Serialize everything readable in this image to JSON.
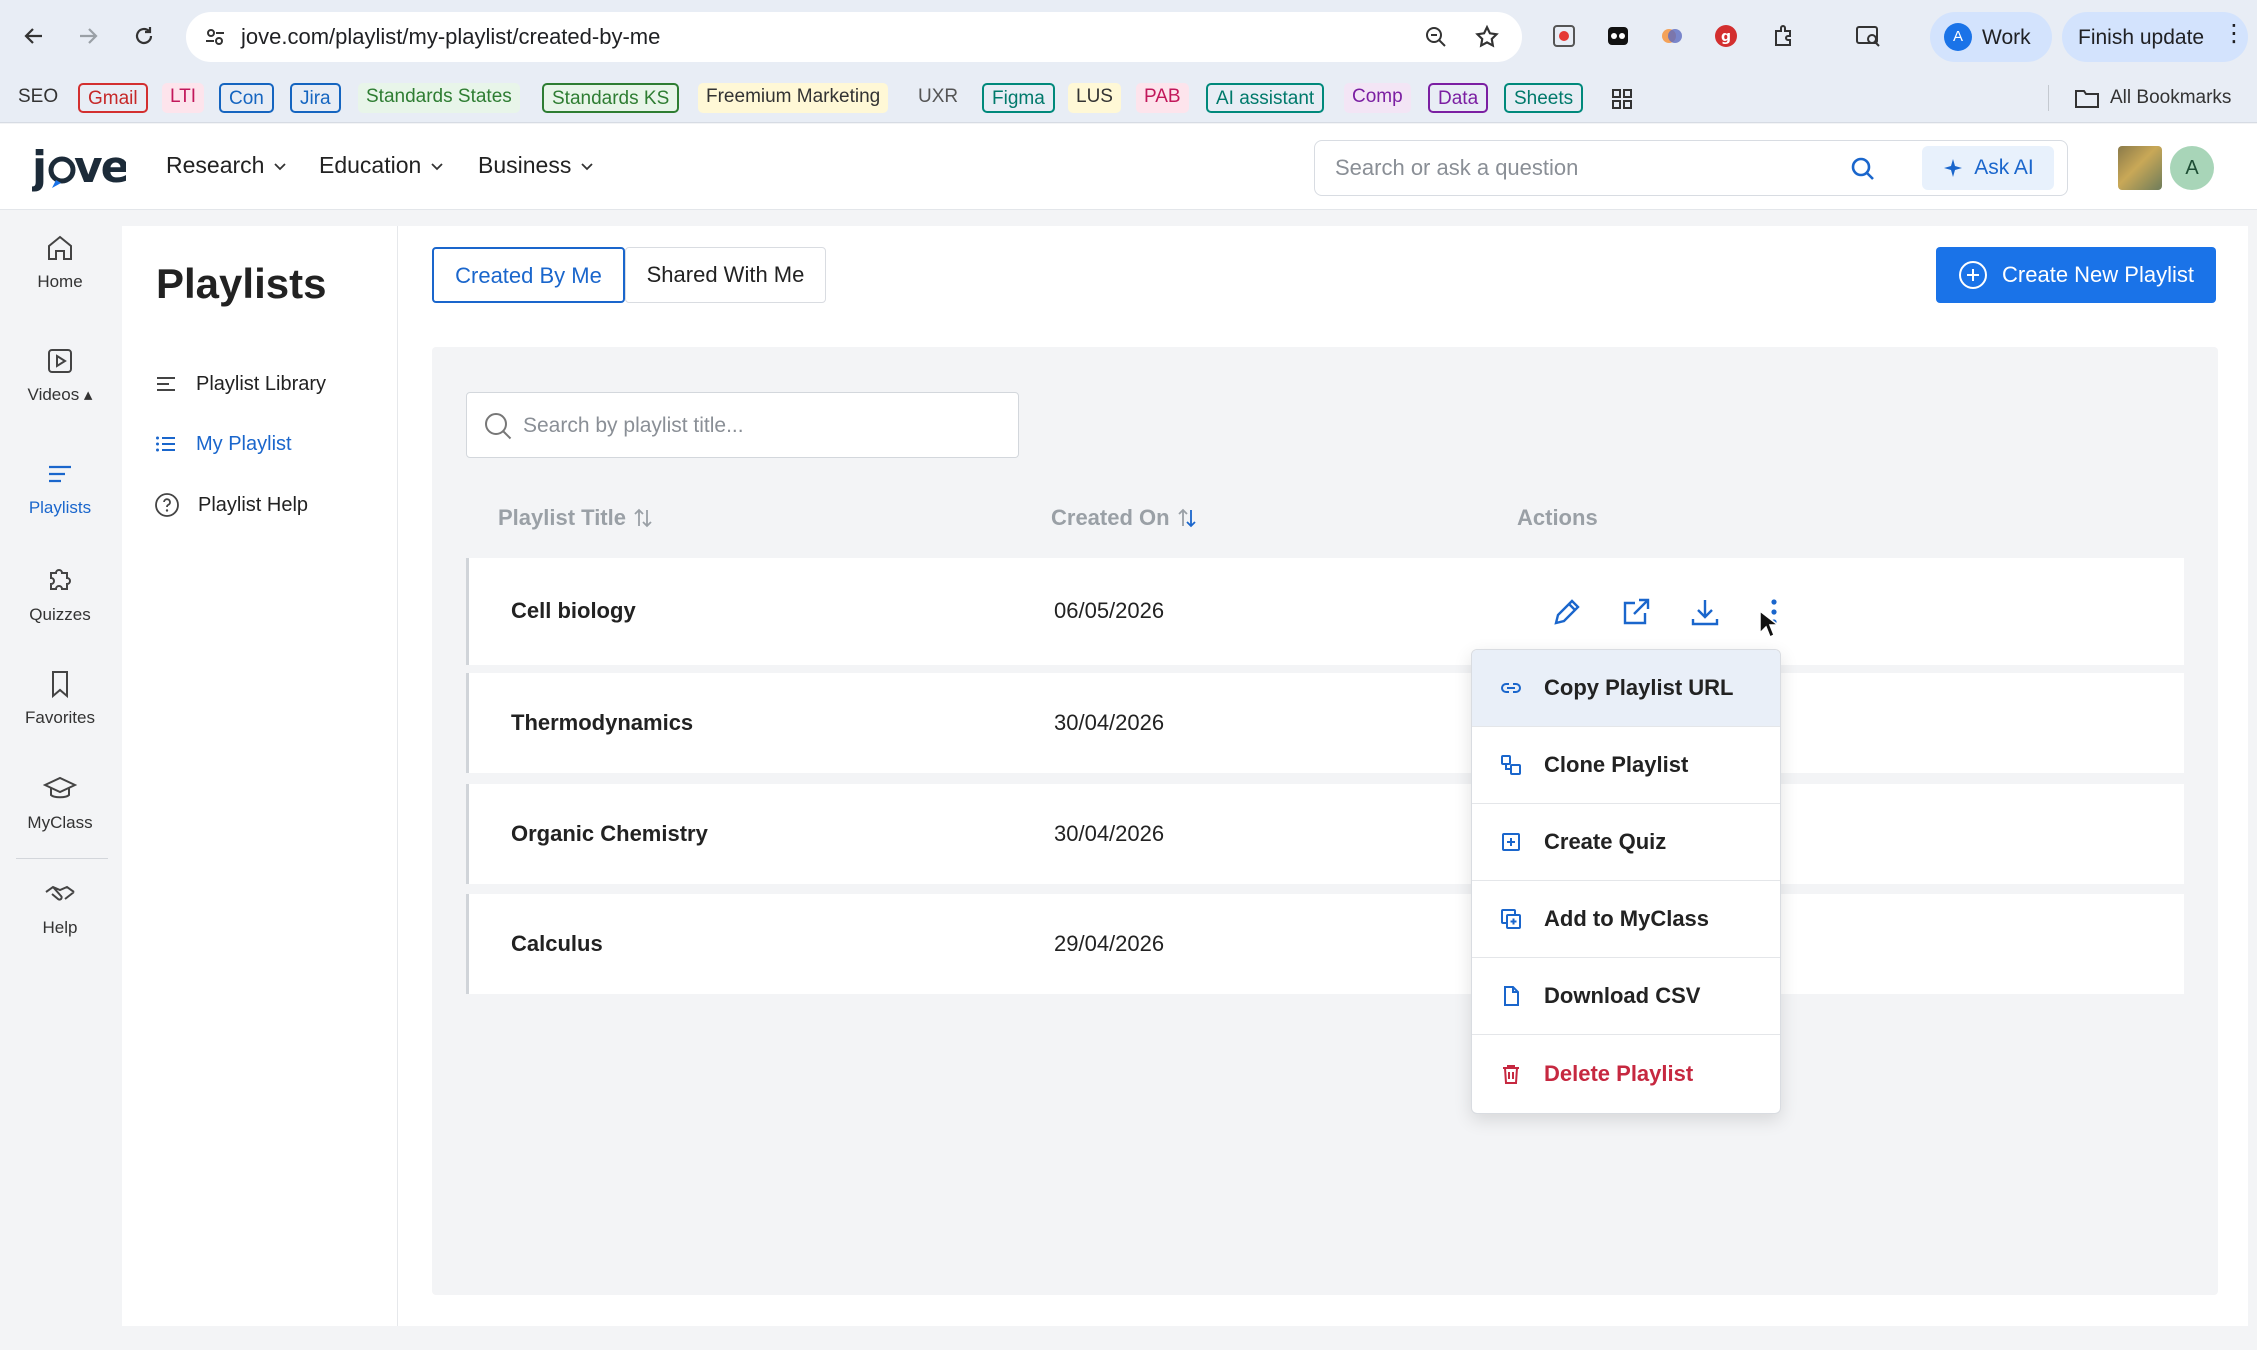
{
  "browser": {
    "url": "jove.com/playlist/my-playlist/created-by-me",
    "profile_label": "Work",
    "profile_initial": "A",
    "update_label": "Finish update",
    "bookmarks": [
      {
        "label": "SEO",
        "style": "plain"
      },
      {
        "label": "Gmail",
        "style": "red"
      },
      {
        "label": "LTI",
        "style": "pink"
      },
      {
        "label": "Con",
        "style": "blue"
      },
      {
        "label": "Jira",
        "style": "blue"
      },
      {
        "label": "Standards States",
        "style": "greenplain"
      },
      {
        "label": "Standards KS",
        "style": "green"
      },
      {
        "label": "Freemium Marketing",
        "style": "yellow"
      },
      {
        "label": "UXR",
        "style": "grey"
      },
      {
        "label": "Figma",
        "style": "teal"
      },
      {
        "label": "LUS",
        "style": "yellow"
      },
      {
        "label": "PAB",
        "style": "pink"
      },
      {
        "label": "AI assistant",
        "style": "teal"
      },
      {
        "label": "Comp",
        "style": "purple"
      },
      {
        "label": "Data",
        "style": "purpleb"
      },
      {
        "label": "Sheets",
        "style": "teal"
      }
    ],
    "all_bookmarks_label": "All Bookmarks"
  },
  "header": {
    "logo": "jove",
    "nav": [
      {
        "label": "Research"
      },
      {
        "label": "Education"
      },
      {
        "label": "Business"
      }
    ],
    "search_placeholder": "Search or ask a question",
    "ask_ai_label": "Ask AI",
    "avatar_initial": "A"
  },
  "rail": {
    "items": [
      {
        "label": "Home",
        "icon": "home-icon"
      },
      {
        "label": "Videos ▴",
        "icon": "video-icon"
      },
      {
        "label": "Playlists",
        "icon": "playlist-icon",
        "active": true
      },
      {
        "label": "Quizzes",
        "icon": "puzzle-icon"
      },
      {
        "label": "Favorites",
        "icon": "bookmark-icon"
      },
      {
        "label": "MyClass",
        "icon": "graduation-cap-icon"
      },
      {
        "label": "Help",
        "icon": "handshake-icon"
      }
    ]
  },
  "sidebar": {
    "title": "Playlists",
    "links": [
      {
        "label": "Playlist Library"
      },
      {
        "label": "My Playlist",
        "active": true
      },
      {
        "label": "Playlist Help"
      }
    ]
  },
  "main": {
    "tabs": [
      {
        "label": "Created By Me",
        "active": true
      },
      {
        "label": "Shared With Me"
      }
    ],
    "create_button_label": "Create New Playlist",
    "search_placeholder": "Search by playlist title...",
    "columns": {
      "title": "Playlist Title",
      "created": "Created On",
      "actions": "Actions"
    },
    "rows": [
      {
        "title": "Cell biology",
        "created": "06/05/2026"
      },
      {
        "title": "Thermodynamics",
        "created": "30/04/2026"
      },
      {
        "title": "Organic Chemistry",
        "created": "30/04/2026"
      },
      {
        "title": "Calculus",
        "created": "29/04/2026"
      }
    ],
    "menu": [
      {
        "label": "Copy Playlist URL",
        "icon": "link-icon"
      },
      {
        "label": "Clone Playlist",
        "icon": "clone-icon"
      },
      {
        "label": "Create Quiz",
        "icon": "plus-square-icon"
      },
      {
        "label": "Add to MyClass",
        "icon": "add-class-icon"
      },
      {
        "label": "Download CSV",
        "icon": "file-icon"
      },
      {
        "label": "Delete Playlist",
        "icon": "trash-icon"
      }
    ],
    "accent_color": "#1a73e8",
    "danger_color": "#c62840"
  }
}
